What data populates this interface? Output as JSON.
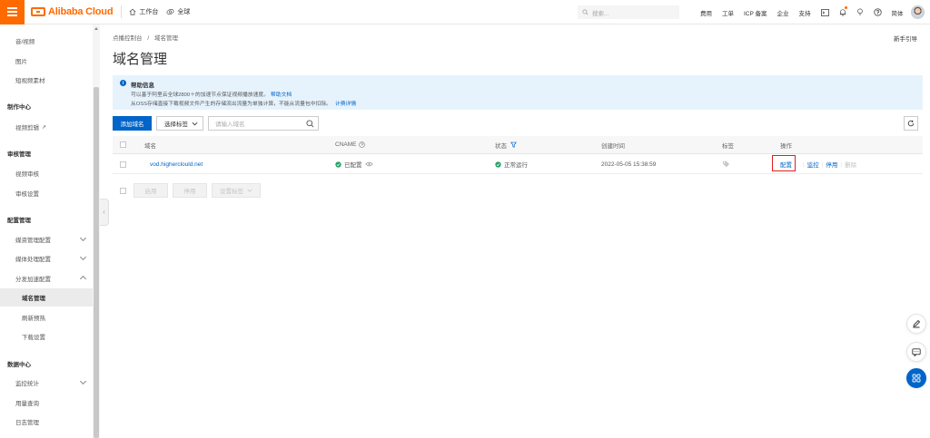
{
  "brand": {
    "logo_text": "Alibaba Cloud",
    "accent": "#ff6a00",
    "primary": "#0064c8"
  },
  "topbar": {
    "workbench": "工作台",
    "global": "全球",
    "search_placeholder": "搜索...",
    "links": [
      "费用",
      "工单",
      "ICP 备案",
      "企业",
      "支持"
    ],
    "lang": "简体"
  },
  "sidebar": {
    "items": [
      {
        "label": "音/视频",
        "level": "l2"
      },
      {
        "label": "图片",
        "level": "l2"
      },
      {
        "label": "短视频素材",
        "level": "l2"
      },
      {
        "label": "制作中心",
        "level": "hdr"
      },
      {
        "label": "视频剪辑",
        "level": "l2",
        "ext": "↗"
      },
      {
        "label": "审核管理",
        "level": "hdr"
      },
      {
        "label": "视频审核",
        "level": "l2"
      },
      {
        "label": "审核设置",
        "level": "l2"
      },
      {
        "label": "配置管理",
        "level": "hdr"
      },
      {
        "label": "媒资管理配置",
        "level": "l2",
        "chev": "down"
      },
      {
        "label": "媒体处理配置",
        "level": "l2",
        "chev": "down"
      },
      {
        "label": "分发加速配置",
        "level": "l2",
        "chev": "up"
      },
      {
        "label": "域名管理",
        "level": "l3",
        "active": true
      },
      {
        "label": "刷新预热",
        "level": "l3"
      },
      {
        "label": "下载设置",
        "level": "l3"
      },
      {
        "label": "数据中心",
        "level": "hdr"
      },
      {
        "label": "监控统计",
        "level": "l2",
        "chev": "down"
      },
      {
        "label": "用量查询",
        "level": "l2"
      },
      {
        "label": "日志管理",
        "level": "l2"
      }
    ]
  },
  "breadcrumb": {
    "root": "点播控制台",
    "sep": "/",
    "current": "域名管理"
  },
  "guide_link": "新手引导",
  "page_title": "域名管理",
  "help": {
    "title": "帮助信息",
    "line1": "可以基于阿里云全球2800＋的加速节点保证视频播放速度。",
    "line1_link": "帮助文档",
    "line2": "从OSS存储直接下载视频文件产生的存储流出流量为单独计算，不能从流量包中扣除。",
    "line2_link": "计费详情"
  },
  "toolbar": {
    "add_domain": "添加域名",
    "select_tag": "选择标签",
    "search_placeholder": "请输入域名"
  },
  "table": {
    "headers": {
      "domain": "域名",
      "cname": "CNAME",
      "status": "状态",
      "created": "创建时间",
      "tag": "标签",
      "ops": "操作"
    },
    "rows": [
      {
        "domain": "vod.higherclould.net",
        "cname": "已配置",
        "status": "正常运行",
        "created": "2022-05-05 15:38:59",
        "ops": {
          "config": "配置",
          "monitor": "监控",
          "stop": "停用",
          "delete": "删除"
        }
      }
    ]
  },
  "bulk": {
    "enable": "启用",
    "disable": "停用",
    "set_tag": "设置标签"
  },
  "status_colors": {
    "ok": "#20a162",
    "highlight": "#e02020"
  }
}
